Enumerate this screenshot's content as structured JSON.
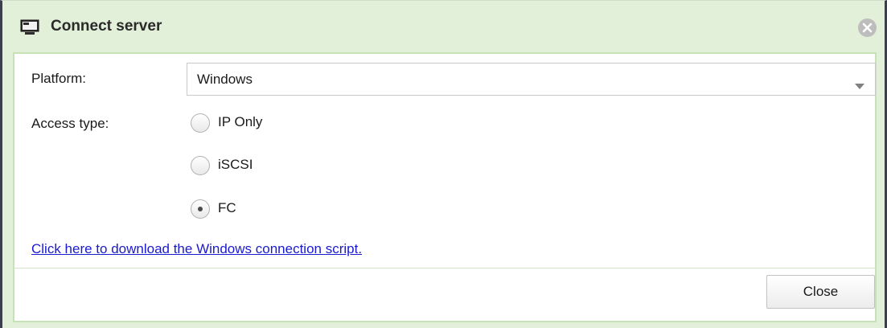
{
  "dialog": {
    "title": "Connect server",
    "title_icon": "server-monitor-icon",
    "close_icon": "close-icon"
  },
  "form": {
    "platform_label": "Platform:",
    "platform_value": "Windows",
    "access_type_label": "Access type:",
    "access_options": [
      {
        "label": "IP Only",
        "selected": false
      },
      {
        "label": "iSCSI",
        "selected": false
      },
      {
        "label": "FC",
        "selected": true
      }
    ],
    "download_link": "Click here to download the Windows connection script."
  },
  "footer": {
    "close_label": "Close"
  },
  "colors": {
    "frame": "#e2efd9",
    "panel_border": "#c7e2b6",
    "link": "#1a1ad0"
  }
}
